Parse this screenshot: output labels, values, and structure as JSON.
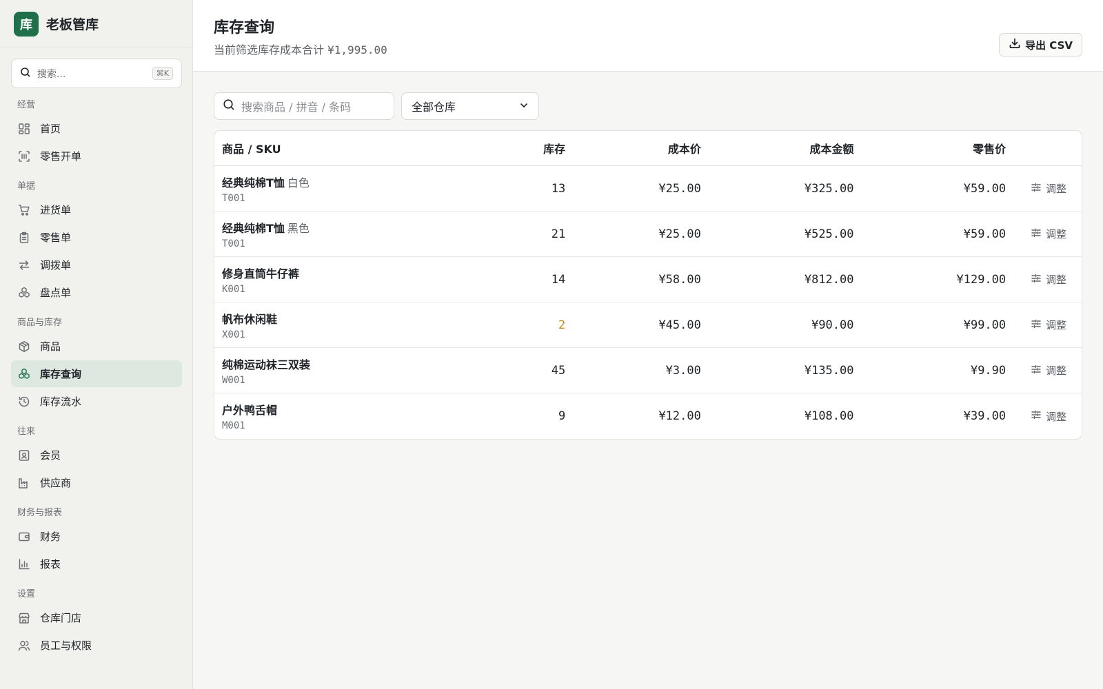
{
  "brand": {
    "logo": "库",
    "name": "老板管库"
  },
  "sidebar_search": {
    "placeholder": "搜索...",
    "shortcut": "⌘K"
  },
  "nav": [
    {
      "section": "经营",
      "items": [
        {
          "label": "首页",
          "icon": "dashboard-icon"
        },
        {
          "label": "零售开单",
          "icon": "scan-icon"
        }
      ]
    },
    {
      "section": "单据",
      "items": [
        {
          "label": "进货单",
          "icon": "cart-icon"
        },
        {
          "label": "零售单",
          "icon": "clipboard-icon"
        },
        {
          "label": "调拨单",
          "icon": "transfer-icon"
        },
        {
          "label": "盘点单",
          "icon": "boxes-icon"
        }
      ]
    },
    {
      "section": "商品与库存",
      "items": [
        {
          "label": "商品",
          "icon": "package-icon"
        },
        {
          "label": "库存查询",
          "icon": "boxes-icon",
          "active": true
        },
        {
          "label": "库存流水",
          "icon": "history-icon"
        }
      ]
    },
    {
      "section": "往来",
      "items": [
        {
          "label": "会员",
          "icon": "member-card-icon"
        },
        {
          "label": "供应商",
          "icon": "factory-icon"
        }
      ]
    },
    {
      "section": "财务与报表",
      "items": [
        {
          "label": "财务",
          "icon": "wallet-icon"
        },
        {
          "label": "报表",
          "icon": "bar-chart-icon"
        }
      ]
    },
    {
      "section": "设置",
      "items": [
        {
          "label": "仓库门店",
          "icon": "store-icon"
        },
        {
          "label": "员工与权限",
          "icon": "users-icon"
        }
      ]
    }
  ],
  "header": {
    "title": "库存查询",
    "subtitle_prefix": "当前筛选库存成本合计 ",
    "subtitle_total": "¥1,995.00",
    "export_label": "导出 CSV"
  },
  "filters": {
    "search_placeholder": "搜索商品 / 拼音 / 条码",
    "warehouse_selected": "全部仓库"
  },
  "table": {
    "columns": [
      "商品 / SKU",
      "库存",
      "成本价",
      "成本金额",
      "零售价"
    ],
    "action_label": "调整",
    "rows": [
      {
        "name": "经典纯棉T恤",
        "variant": "白色",
        "sku": "T001",
        "stock": "13",
        "low": false,
        "cost": "¥25.00",
        "amount": "¥325.00",
        "retail": "¥59.00"
      },
      {
        "name": "经典纯棉T恤",
        "variant": "黑色",
        "sku": "T001",
        "stock": "21",
        "low": false,
        "cost": "¥25.00",
        "amount": "¥525.00",
        "retail": "¥59.00"
      },
      {
        "name": "修身直筒牛仔裤",
        "variant": "",
        "sku": "K001",
        "stock": "14",
        "low": false,
        "cost": "¥58.00",
        "amount": "¥812.00",
        "retail": "¥129.00"
      },
      {
        "name": "帆布休闲鞋",
        "variant": "",
        "sku": "X001",
        "stock": "2",
        "low": true,
        "cost": "¥45.00",
        "amount": "¥90.00",
        "retail": "¥99.00"
      },
      {
        "name": "纯棉运动袜三双装",
        "variant": "",
        "sku": "W001",
        "stock": "45",
        "low": false,
        "cost": "¥3.00",
        "amount": "¥135.00",
        "retail": "¥9.90"
      },
      {
        "name": "户外鸭舌帽",
        "variant": "",
        "sku": "M001",
        "stock": "9",
        "low": false,
        "cost": "¥12.00",
        "amount": "¥108.00",
        "retail": "¥39.00"
      }
    ]
  },
  "colors": {
    "accent": "#1f6f4a",
    "active_bg": "#dde8e1",
    "low_stock": "#c98a16"
  }
}
